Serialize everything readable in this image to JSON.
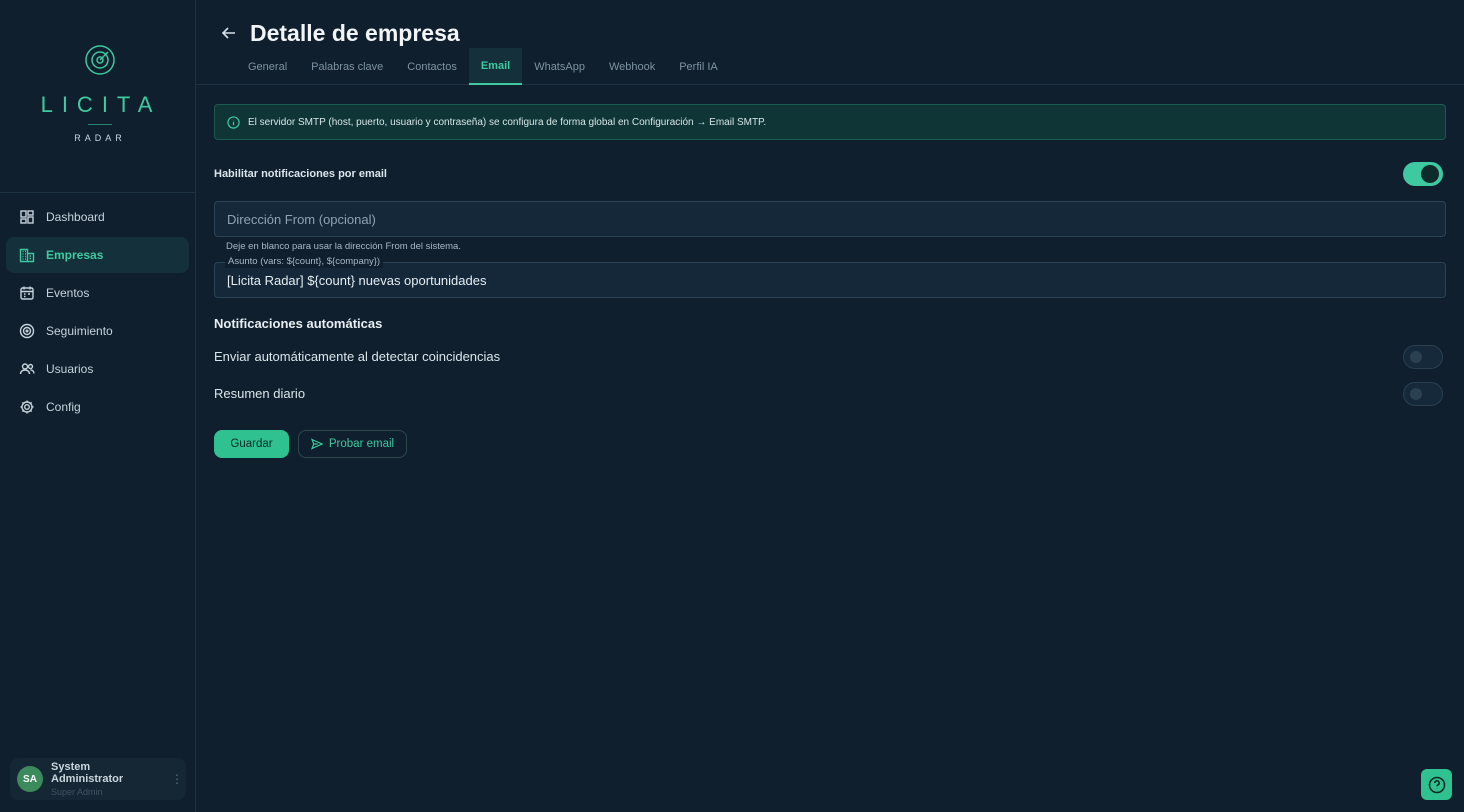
{
  "brand": {
    "name": "LICITA",
    "subtitle": "RADAR",
    "accent": "#3ec9a0"
  },
  "sidebar": {
    "items": [
      {
        "label": "Dashboard",
        "icon": "dashboard-icon",
        "active": false
      },
      {
        "label": "Empresas",
        "icon": "building-icon",
        "active": true
      },
      {
        "label": "Eventos",
        "icon": "calendar-icon",
        "active": false
      },
      {
        "label": "Seguimiento",
        "icon": "radar-icon",
        "active": false
      },
      {
        "label": "Usuarios",
        "icon": "users-icon",
        "active": false
      },
      {
        "label": "Config",
        "icon": "gear-icon",
        "active": false
      }
    ],
    "user": {
      "initials": "SA",
      "name": "System Administrator",
      "role": "Super Admin"
    }
  },
  "header": {
    "title": "Detalle de empresa",
    "tabs": [
      {
        "label": "General",
        "active": false
      },
      {
        "label": "Palabras clave",
        "active": false
      },
      {
        "label": "Contactos",
        "active": false
      },
      {
        "label": "Email",
        "active": true
      },
      {
        "label": "WhatsApp",
        "active": false
      },
      {
        "label": "Webhook",
        "active": false
      },
      {
        "label": "Perfil IA",
        "active": false
      }
    ]
  },
  "email": {
    "info": "El servidor SMTP (host, puerto, usuario y contraseña) se configura de forma global en Configuración → Email SMTP.",
    "enable_label": "Habilitar notificaciones por email",
    "enable_on": true,
    "from_placeholder": "Dirección From (opcional)",
    "from_value": "",
    "from_helper": "Deje en blanco para usar la dirección From del sistema.",
    "subject_label": "Asunto (vars: ${count}, ${company})",
    "subject_value": "[Licita Radar] ${count} nuevas oportunidades",
    "auto_title": "Notificaciones automáticas",
    "auto_send_label": "Enviar automáticamente al detectar coincidencias",
    "auto_send_on": false,
    "daily_label": "Resumen diario",
    "daily_on": false,
    "save_label": "Guardar",
    "test_label": "Probar email"
  },
  "help": {
    "icon": "help-icon"
  }
}
